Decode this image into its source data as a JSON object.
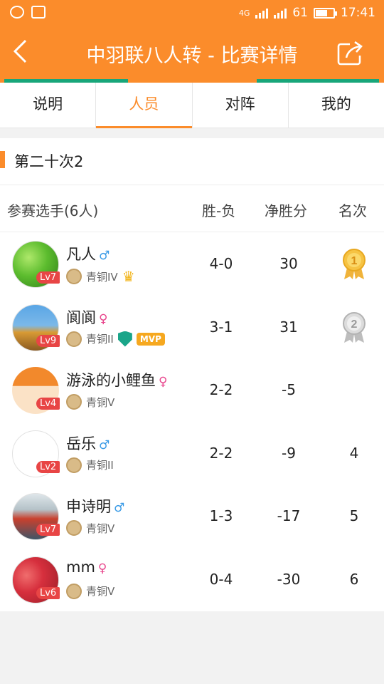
{
  "status_bar": {
    "network": "4G",
    "battery": "61",
    "time": "17:41"
  },
  "header": {
    "title": "中羽联八人转 - 比赛详情"
  },
  "tabs": [
    {
      "label": "说明",
      "active": false
    },
    {
      "label": "人员",
      "active": true
    },
    {
      "label": "对阵",
      "active": false
    },
    {
      "label": "我的",
      "active": false
    }
  ],
  "section": {
    "title": "第二十次2"
  },
  "table": {
    "headers": {
      "player": "参赛选手(6人)",
      "record": "胜-负",
      "net": "净胜分",
      "rank": "名次"
    },
    "rows": [
      {
        "name": "凡人",
        "gender": "♂",
        "level": "Lv7",
        "rank_title": "青铜IV",
        "record": "4-0",
        "net": "30",
        "place": "",
        "medal": "1",
        "crown": true,
        "mvp": false
      },
      {
        "name": "阆阆",
        "gender": "♀",
        "level": "Lv9",
        "rank_title": "青铜II",
        "record": "3-1",
        "net": "31",
        "place": "",
        "medal": "2",
        "crown": false,
        "mvp": true,
        "mvp_label": "MVP"
      },
      {
        "name": "游泳的小鲤鱼",
        "gender": "♀",
        "level": "Lv4",
        "rank_title": "青铜V",
        "record": "2-2",
        "net": "-5",
        "place": ""
      },
      {
        "name": "岳乐",
        "gender": "♂",
        "level": "Lv2",
        "rank_title": "青铜II",
        "record": "2-2",
        "net": "-9",
        "place": "4"
      },
      {
        "name": "申诗明",
        "gender": "♂",
        "level": "Lv7",
        "rank_title": "青铜V",
        "record": "1-3",
        "net": "-17",
        "place": "5"
      },
      {
        "name": "mm",
        "gender": "♀",
        "level": "Lv6",
        "rank_title": "青铜V",
        "record": "0-4",
        "net": "-30",
        "place": "6"
      }
    ]
  },
  "colors": {
    "accent": "#fb8c2b",
    "green": "#18a67a",
    "level_badge": "#e84545",
    "male": "#3b9be6",
    "female": "#e8468d"
  }
}
